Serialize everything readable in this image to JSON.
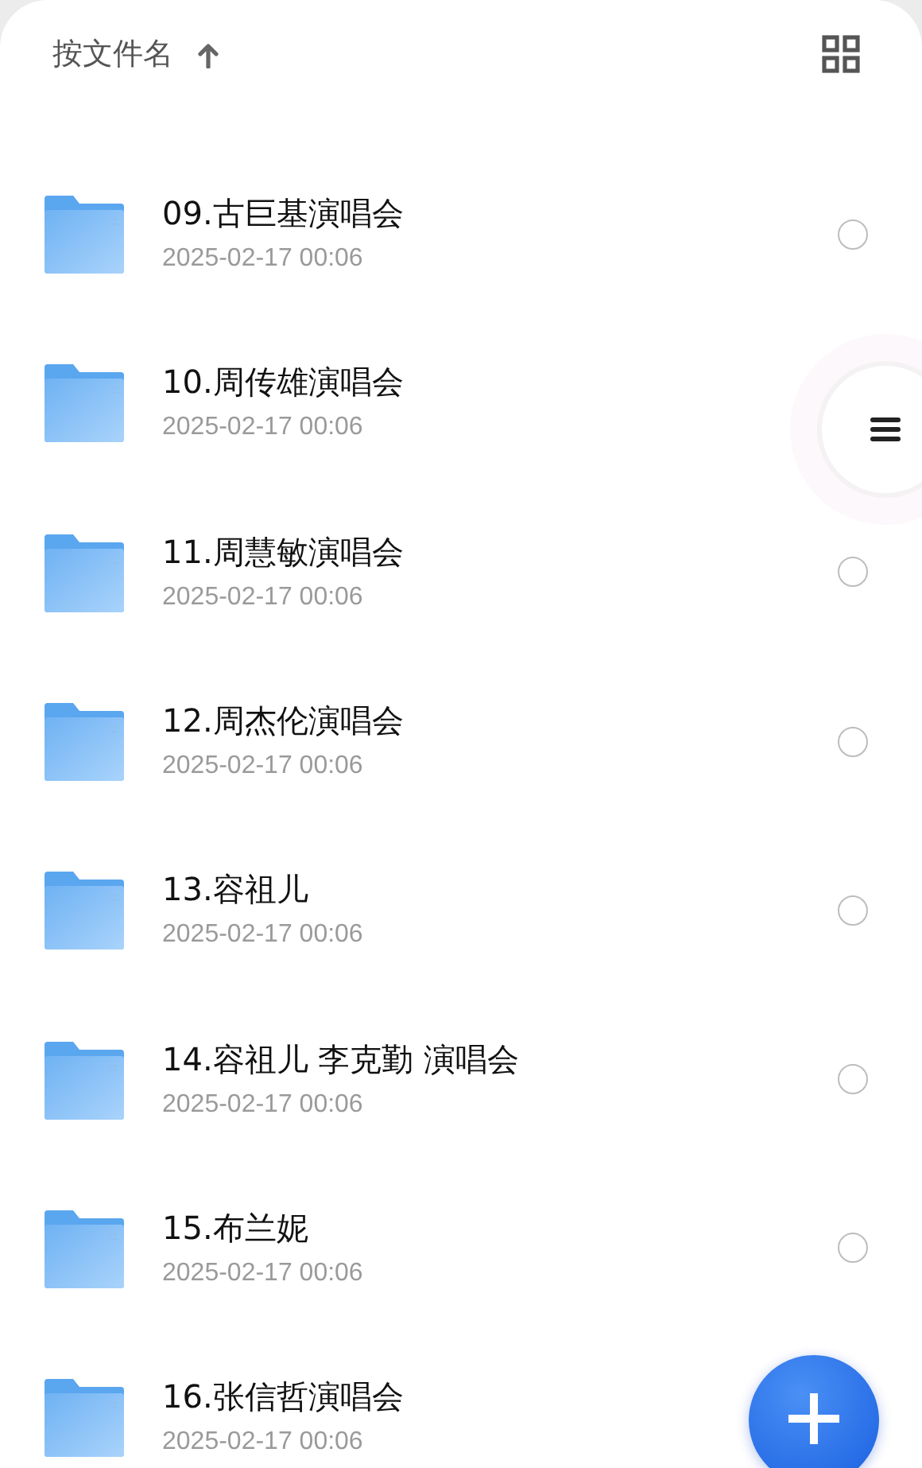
{
  "sort_bar": {
    "label": "按文件名"
  },
  "folders": [
    {
      "name": "09.古巨基演唱会",
      "date": "2025-02-17 00:06",
      "selected": false
    },
    {
      "name": "10.周传雄演唱会",
      "date": "2025-02-17 00:06"
    },
    {
      "name": "11.周慧敏演唱会",
      "date": "2025-02-17 00:06",
      "selected": false
    },
    {
      "name": "12.周杰伦演唱会",
      "date": "2025-02-17 00:06",
      "selected": false
    },
    {
      "name": "13.容祖儿",
      "date": "2025-02-17 00:06",
      "selected": false
    },
    {
      "name": "14.容祖儿 李克勤 演唱会",
      "date": "2025-02-17 00:06",
      "selected": false
    },
    {
      "name": "15.布兰妮",
      "date": "2025-02-17 00:06",
      "selected": false
    },
    {
      "name": "16.张信哲演唱会",
      "date": "2025-02-17 00:06"
    }
  ]
}
